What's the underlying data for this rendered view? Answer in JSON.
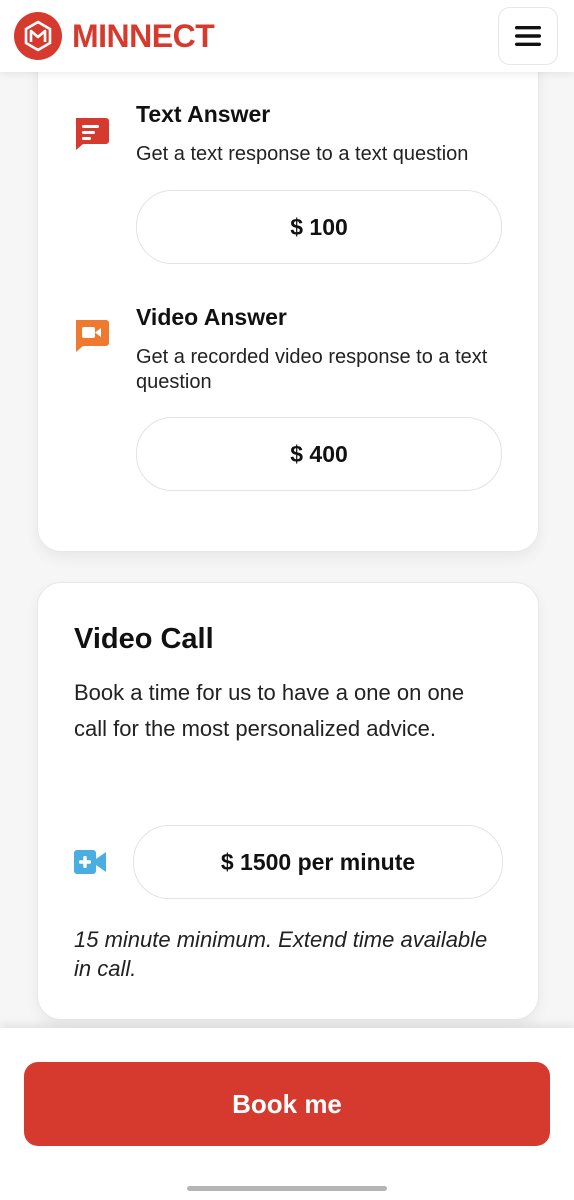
{
  "header": {
    "brand": "MINNECT",
    "brand_color": "#d63a2f",
    "logo_icon": "minnect-logo-icon",
    "menu_icon": "hamburger-menu-icon"
  },
  "services": [
    {
      "title": "Text Answer",
      "description": "Get a text response to a text question",
      "price": "$ 100",
      "icon": "text-message-icon",
      "icon_color": "#d63a2f"
    },
    {
      "title": "Video Answer",
      "description": "Get a recorded video response to a text question",
      "price": "$ 400",
      "icon": "video-message-icon",
      "icon_color": "#ee7a2f"
    }
  ],
  "video_call": {
    "title": "Video Call",
    "description": "Book a time for us to have a one on one call for the most personalized advice.",
    "price": "$ 1500 per minute",
    "icon": "video-call-add-icon",
    "icon_color": "#4aaee0",
    "note": "15 minute minimum. Extend time available in call."
  },
  "footer": {
    "book_label": "Book me",
    "button_color": "#d63a2f"
  }
}
